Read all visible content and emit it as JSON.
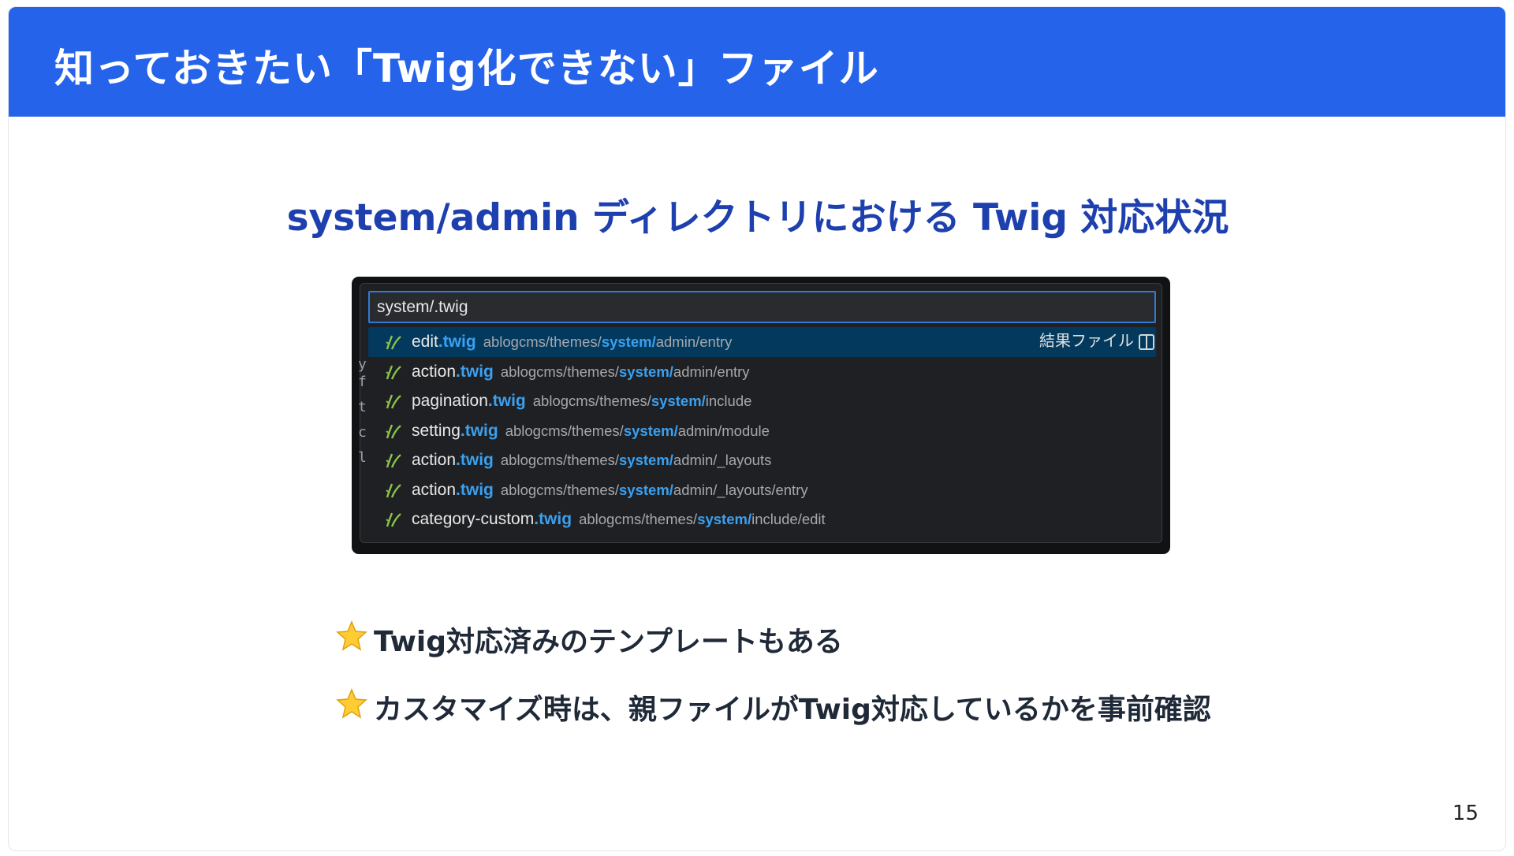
{
  "slide": {
    "title": "知っておきたい「Twig化できない」ファイル",
    "section_heading": "system/admin ディレクトリにおける Twig 対応状況",
    "page_number": "15",
    "header_color": "#2563eb",
    "heading_color": "#1e40af"
  },
  "screenshot": {
    "search_value": "system/.twig",
    "results": [
      {
        "name": "edit",
        "ext": ".twig",
        "path_prefix": "ablogcms/themes/",
        "path_highlight": "system/",
        "path_suffix": "admin/entry",
        "meta": "結果ファイル"
      },
      {
        "name": "action",
        "ext": ".twig",
        "path_prefix": "ablogcms/themes/",
        "path_highlight": "system/",
        "path_suffix": "admin/entry",
        "meta": ""
      },
      {
        "name": "pagination",
        "ext": ".twig",
        "path_prefix": "ablogcms/themes/",
        "path_highlight": "system/",
        "path_suffix": "include",
        "meta": ""
      },
      {
        "name": "setting",
        "ext": ".twig",
        "path_prefix": "ablogcms/themes/",
        "path_highlight": "system/",
        "path_suffix": "admin/module",
        "meta": ""
      },
      {
        "name": "action",
        "ext": ".twig",
        "path_prefix": "ablogcms/themes/",
        "path_highlight": "system/",
        "path_suffix": "admin/_layouts",
        "meta": ""
      },
      {
        "name": "action",
        "ext": ".twig",
        "path_prefix": "ablogcms/themes/",
        "path_highlight": "system/",
        "path_suffix": "admin/_layouts/entry",
        "meta": ""
      },
      {
        "name": "category-custom",
        "ext": ".twig",
        "path_prefix": "ablogcms/themes/",
        "path_highlight": "system/",
        "path_suffix": "include/edit",
        "meta": ""
      }
    ],
    "icons": {
      "file": "twig-file-icon",
      "split": "split-editor-icon"
    },
    "highlight_color": "#3aa0f0",
    "selected_row_color": "#04395e"
  },
  "bullets": [
    {
      "icon": "star-icon",
      "text": "Twig対応済みのテンプレートもある"
    },
    {
      "icon": "star-icon",
      "text": "カスタマイズ時は、親ファイルがTwig対応しているかを事前確認"
    }
  ]
}
